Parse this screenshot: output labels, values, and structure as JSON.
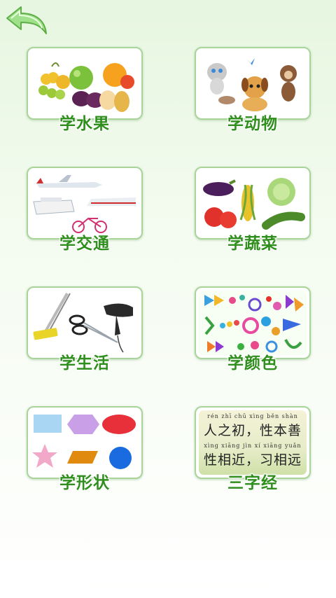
{
  "back_button": {
    "icon": "back-arrow-icon"
  },
  "tiles": [
    {
      "label": "学水果",
      "icon": "fruits-picture"
    },
    {
      "label": "学动物",
      "icon": "animals-picture"
    },
    {
      "label": "学交通",
      "icon": "vehicles-picture"
    },
    {
      "label": "学蔬菜",
      "icon": "vegetables-picture"
    },
    {
      "label": "学生活",
      "icon": "daily-items-picture"
    },
    {
      "label": "学颜色",
      "icon": "colors-picture"
    },
    {
      "label": "学形状",
      "icon": "shapes-picture"
    },
    {
      "label": "三字经",
      "icon": "three-character-classic-picture"
    }
  ],
  "poem": {
    "pinyin_line1": "rén  zhī  chū   xìng běn shàn",
    "line1": "人之初，性本善",
    "pinyin_line2": "xìng xiāng  jìn    xí  xiāng yuǎn",
    "line2": "性相近，习相远"
  },
  "colors": {
    "label": "#2f8f1d",
    "border": "#a9d59a",
    "arrow": "#8fd67a"
  }
}
